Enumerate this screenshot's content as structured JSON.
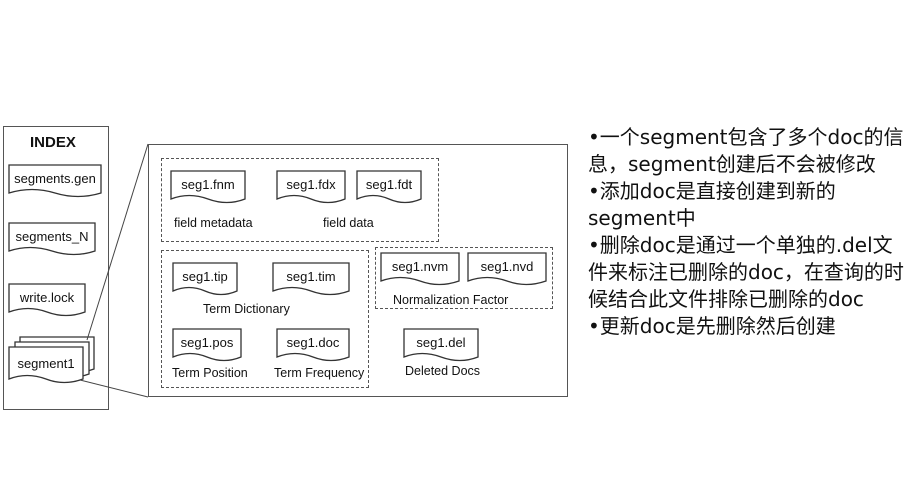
{
  "index": {
    "title": "INDEX",
    "files": [
      "segments.gen",
      "segments_N",
      "write.lock",
      "segment1"
    ]
  },
  "segment": {
    "fnm": "seg1.fnm",
    "fdx": "seg1.fdx",
    "fdt": "seg1.fdt",
    "field_metadata": "field metadata",
    "field_data": "field data",
    "tip": "seg1.tip",
    "tim": "seg1.tim",
    "term_dictionary": "Term Dictionary",
    "pos": "seg1.pos",
    "doc": "seg1.doc",
    "term_position": "Term Position",
    "term_frequency": "Term Frequency",
    "nvm": "seg1.nvm",
    "nvd": "seg1.nvd",
    "normalization_factor": "Normalization Factor",
    "del": "seg1.del",
    "deleted_docs": "Deleted Docs"
  },
  "notes": [
    "•一个segment包含了多个doc的信息，segment创建后不会被修改",
    "•添加doc是直接创建到新的segment中",
    "•删除doc是通过一个单独的.del文件来标注已删除的doc，在查询的时候结合此文件排除已删除的doc",
    "•更新doc是先删除然后创建"
  ]
}
